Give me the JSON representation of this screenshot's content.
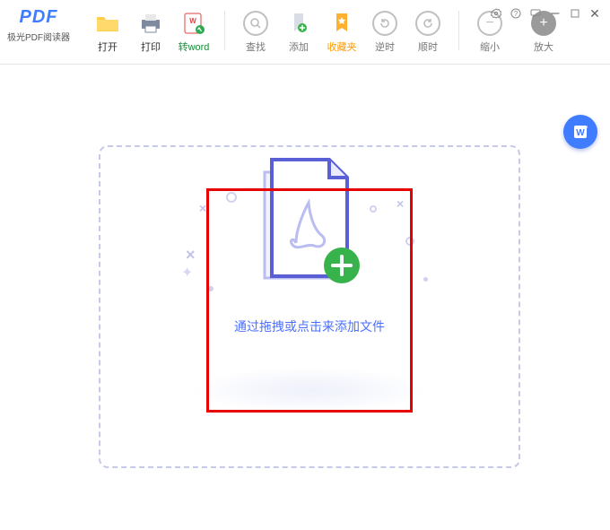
{
  "app": {
    "logo": "PDF",
    "subtitle": "极光PDF阅读器"
  },
  "toolbar": {
    "open": "打开",
    "print": "打印",
    "toword": "转word",
    "find": "查找",
    "add": "添加",
    "fav": "收藏夹",
    "ccw": "逆时",
    "cw": "顺时",
    "zoomout": "缩小",
    "zoomin": "放大"
  },
  "dropzone": {
    "hint": "通过拖拽或点击来添加文件"
  }
}
